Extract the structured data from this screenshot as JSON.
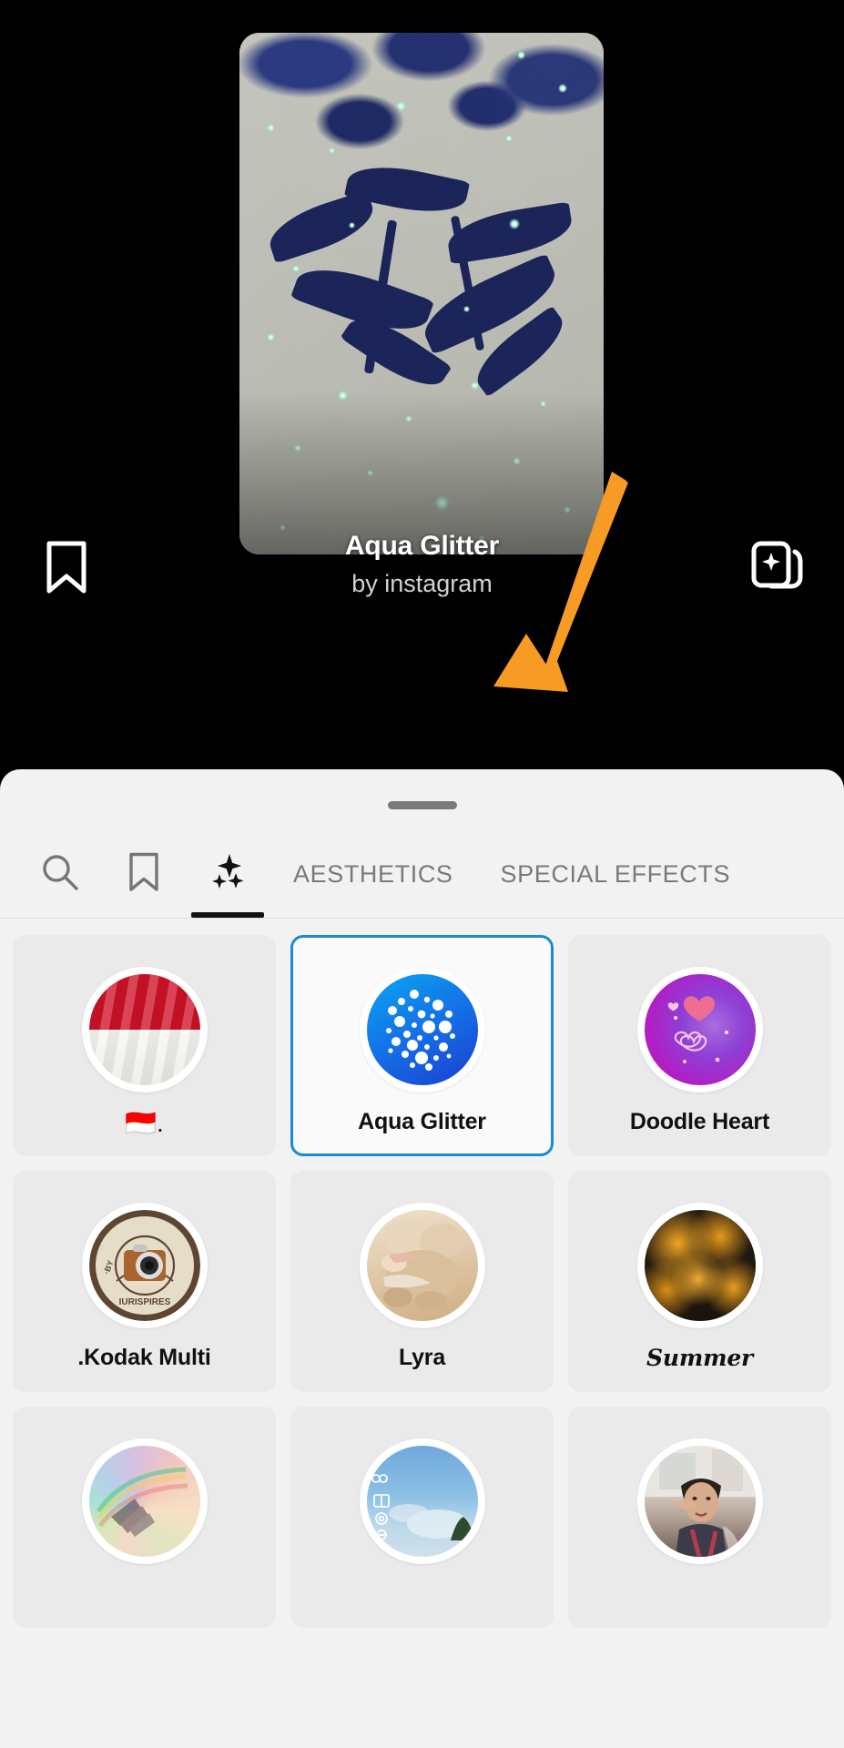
{
  "preview": {
    "title": "Aqua Glitter",
    "author": "by instagram",
    "save_icon": "bookmark-icon",
    "add_icon": "add-to-story-icon"
  },
  "sheet": {
    "drag_handle": "drag-handle",
    "tabs": [
      {
        "id": "search",
        "label": "",
        "icon": "search-icon",
        "active": false
      },
      {
        "id": "saved",
        "label": "",
        "icon": "bookmark-icon",
        "active": false
      },
      {
        "id": "effects",
        "label": "",
        "icon": "sparkles-icon",
        "active": true
      },
      {
        "id": "aesthetics",
        "label": "AESTHETICS",
        "icon": "",
        "active": false
      },
      {
        "id": "special-effects",
        "label": "SPECIAL EFFECTS",
        "icon": "",
        "active": false
      }
    ]
  },
  "grid": {
    "items": [
      {
        "label": "🇮🇩.",
        "art": "t-flag-id",
        "selected": false,
        "label_style": "flag"
      },
      {
        "label": "Aqua Glitter",
        "art": "t-aqua",
        "selected": true,
        "label_style": ""
      },
      {
        "label": "Doodle Heart",
        "art": "t-doodle",
        "selected": false,
        "label_style": ""
      },
      {
        "label": ".Kodak Multi",
        "art": "t-kodak",
        "selected": false,
        "label_style": ""
      },
      {
        "label": "Lyra",
        "art": "t-lyra",
        "selected": false,
        "label_style": ""
      },
      {
        "label": "Summer",
        "art": "t-summer",
        "selected": false,
        "label_style": "script"
      },
      {
        "label": "",
        "art": "t-prism",
        "selected": false,
        "label_style": ""
      },
      {
        "label": "",
        "art": "t-sky",
        "selected": false,
        "label_style": ""
      },
      {
        "label": "",
        "art": "t-person",
        "selected": false,
        "label_style": ""
      }
    ]
  },
  "annotation": {
    "arrow_color": "#F79B25",
    "points_to": "SPECIAL EFFECTS"
  },
  "colors": {
    "background": "#000000",
    "sheet_background": "#f2f2f2",
    "card_background": "#eaeaea",
    "selected_border": "#1a8bd0",
    "tab_inactive": "#7a7a7a",
    "tab_active": "#111111",
    "arrow": "#F79B25"
  }
}
